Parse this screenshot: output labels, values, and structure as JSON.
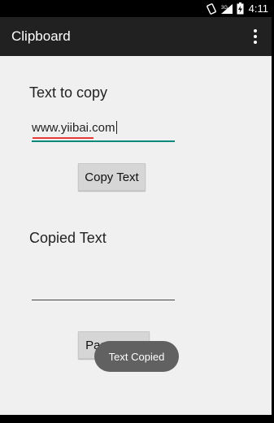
{
  "status_bar": {
    "network_label": "3G",
    "time": "4:11"
  },
  "action_bar": {
    "title": "Clipboard",
    "overflow_icon": "more-vert-icon"
  },
  "copy_section": {
    "label": "Text to copy",
    "input_value": "www.yiibai.com",
    "button_label": "Copy Text"
  },
  "paste_section": {
    "label": "Copied Text",
    "input_value": "",
    "button_label": "Paste Text"
  },
  "toast": {
    "message": "Text Copied"
  },
  "colors": {
    "action_bar": "#212121",
    "accent": "#00897b",
    "toast": "#616161"
  }
}
